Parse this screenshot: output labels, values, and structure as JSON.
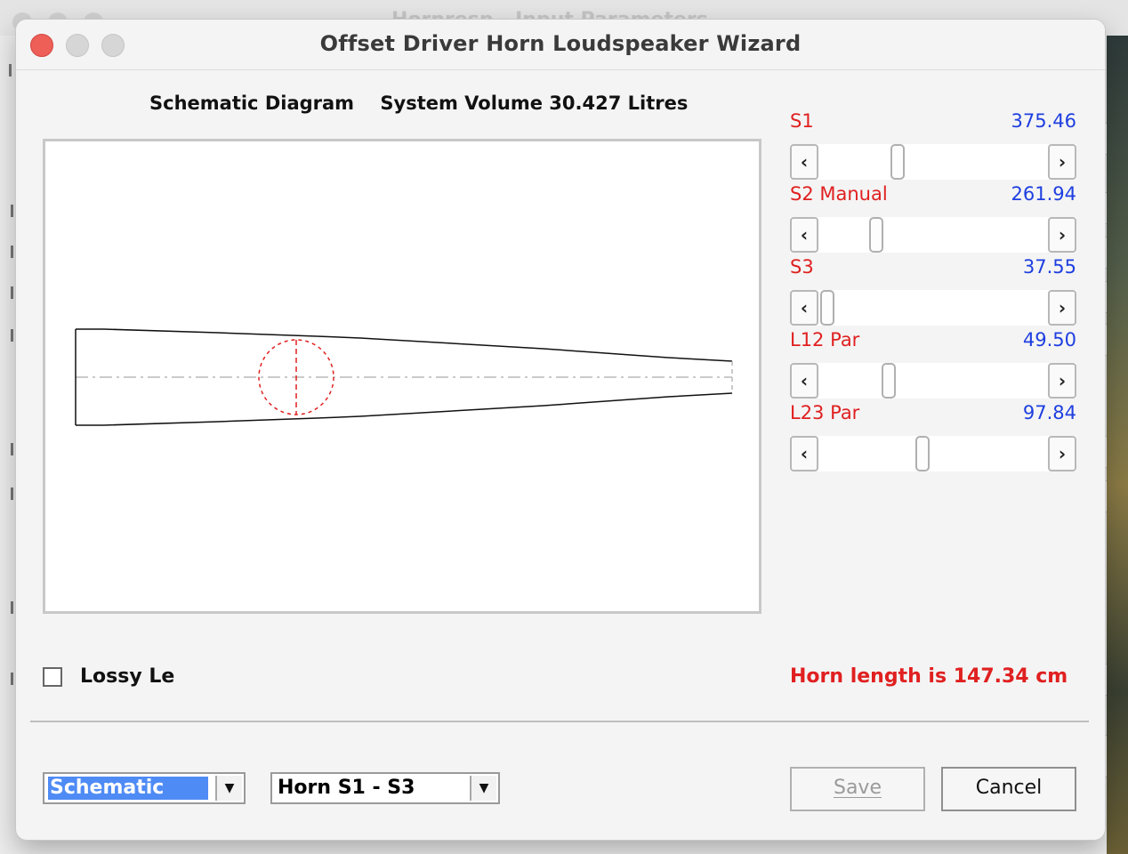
{
  "background": {
    "title": "Hornresp - Input Parameters"
  },
  "dialog": {
    "title": "Offset Driver Horn Loudspeaker Wizard",
    "heading_left": "Schematic Diagram",
    "heading_right": "System Volume 30.427 Litres"
  },
  "params": [
    {
      "label": "S1",
      "value": "375.46",
      "position": 0.33
    },
    {
      "label": "S2  Manual",
      "value": "261.94",
      "position": 0.23
    },
    {
      "label": "S3",
      "value": "37.55",
      "position": 0.0
    },
    {
      "label": "L12  Par",
      "value": "49.50",
      "position": 0.29
    },
    {
      "label": "L23  Par",
      "value": "97.84",
      "position": 0.45
    }
  ],
  "lossy": {
    "label": "Lossy Le",
    "checked": false
  },
  "horn_length": "Horn length is 147.34 cm",
  "view_combo": {
    "value": "Schematic"
  },
  "horn_combo": {
    "value": "Horn S1 - S3"
  },
  "buttons": {
    "save": "Save",
    "cancel": "Cancel"
  },
  "icons": {
    "left_arrow": "chevron-left-icon",
    "right_arrow": "chevron-right-icon",
    "dropdown": "caret-down-icon"
  },
  "colors": {
    "label_red": "#e02020",
    "value_blue": "#1e3ee0",
    "selection_blue": "#4f8bf5"
  }
}
